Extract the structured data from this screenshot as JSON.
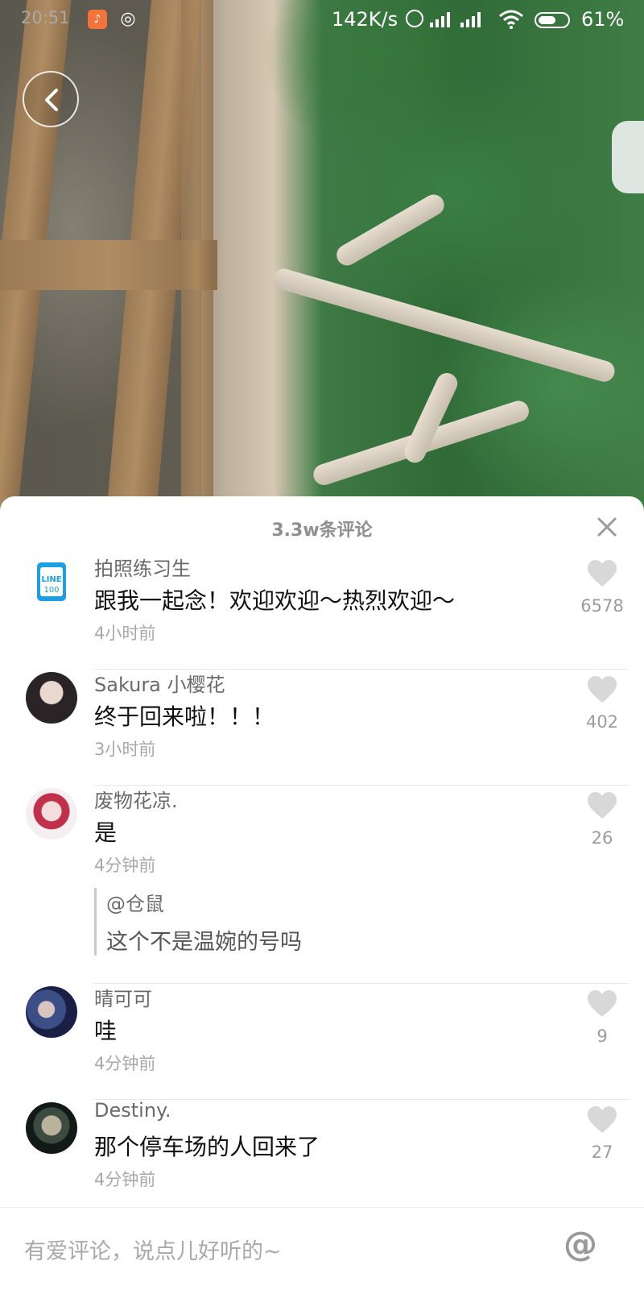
{
  "status_bar": {
    "time": "20:51",
    "network_speed": "142K/s",
    "battery_percent": "61%",
    "battery_level": 0.61,
    "icons": [
      "app-notification-icon",
      "weibo-icon",
      "alarm-icon",
      "signal-icon",
      "signal-icon",
      "wifi-icon",
      "battery-icon"
    ]
  },
  "comments_panel": {
    "title": "3.3w条评论",
    "comments": [
      {
        "user": "拍照练习生",
        "text": "跟我一起念！欢迎欢迎～热烈欢迎～",
        "time": "4小时前",
        "likes": "6578",
        "avatar": "line-100-logo"
      },
      {
        "user": "Sakura 小樱花",
        "text": "终于回来啦！！！",
        "time": "3小时前",
        "likes": "402",
        "avatar": "girl-photo"
      },
      {
        "user": "废物花凉.",
        "text": "是",
        "time": "4分钟前",
        "likes": "26",
        "avatar": "anime-girl",
        "reply": {
          "user": "@仓鼠",
          "text": "这个不是温婉的号吗"
        }
      },
      {
        "user": "晴可可",
        "text": "哇",
        "time": "4分钟前",
        "likes": "9",
        "avatar": "anime-night"
      },
      {
        "user": "Destiny.",
        "text": "那个停车场的人回来了",
        "time": "4分钟前",
        "likes": "27",
        "avatar": "anime-dark"
      }
    ]
  },
  "input": {
    "placeholder": "有爱评论，说点儿好听的~",
    "mention_symbol": "@"
  },
  "colors": {
    "like_heart": "#d8d8d8",
    "secondary_text": "#a8a8a8"
  }
}
